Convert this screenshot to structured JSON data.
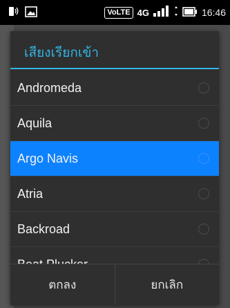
{
  "status_bar": {
    "volte_label": "VoLTE",
    "network_label": "4G",
    "time": "16:46"
  },
  "dialog": {
    "title": "เสียงเรียกเข้า",
    "items": [
      {
        "label": "Andromeda",
        "selected": false
      },
      {
        "label": "Aquila",
        "selected": false
      },
      {
        "label": "Argo Navis",
        "selected": true
      },
      {
        "label": "Atria",
        "selected": false
      },
      {
        "label": "Backroad",
        "selected": false
      },
      {
        "label": "Beat Plucker",
        "selected": false
      }
    ],
    "ok_label": "ตกลง",
    "cancel_label": "ยกเลิก"
  },
  "colors": {
    "accent": "#33b5e5",
    "selected_row": "#0d82ff"
  }
}
